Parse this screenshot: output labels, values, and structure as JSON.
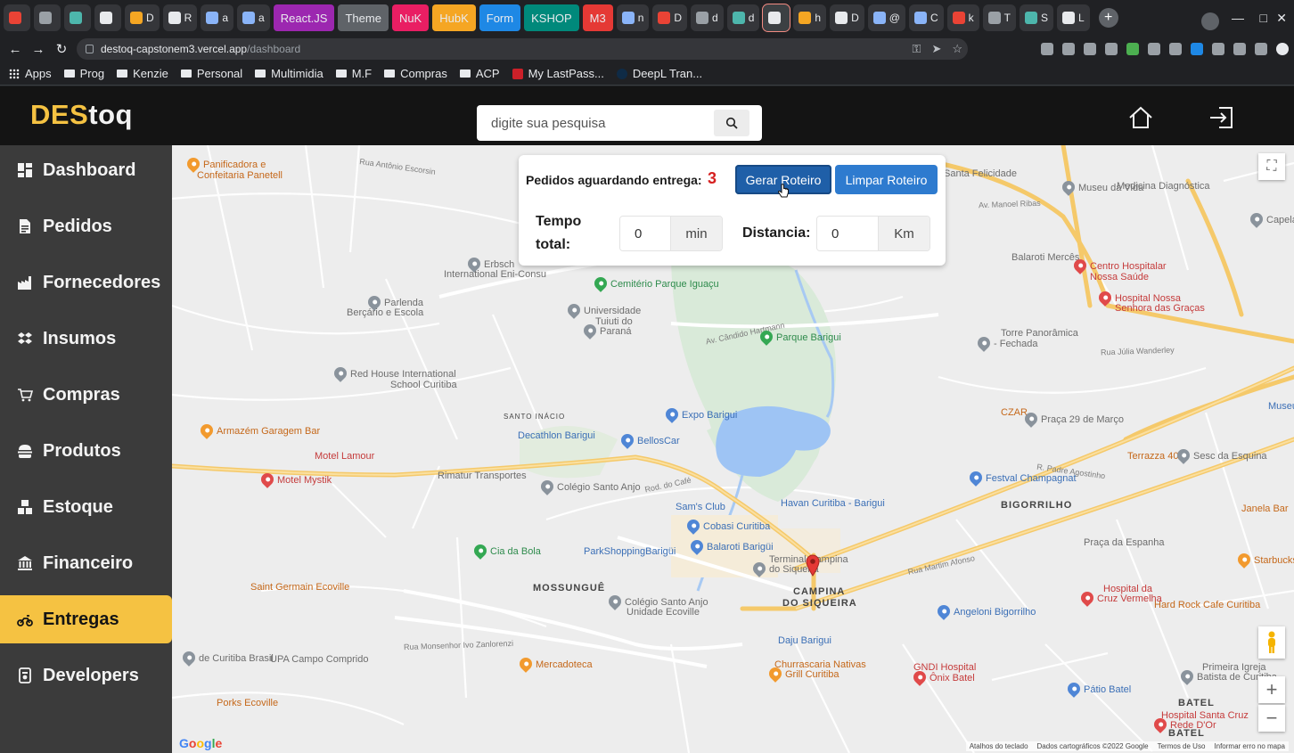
{
  "browser": {
    "tabs": [
      {
        "label": ""
      },
      {
        "label": ""
      },
      {
        "label": ""
      },
      {
        "label": ""
      },
      {
        "label": "D"
      },
      {
        "label": "R"
      },
      {
        "label": "a"
      },
      {
        "label": "a"
      },
      {
        "label": "React.JS",
        "color": "#9c27b0"
      },
      {
        "label": "Theme",
        "color": "#5f6368"
      },
      {
        "label": "NuK",
        "color": "#e91e63"
      },
      {
        "label": "HubK",
        "color": "#f5a623"
      },
      {
        "label": "Form",
        "color": "#1e88e5"
      },
      {
        "label": "KSHOP",
        "color": "#00897b"
      },
      {
        "label": "M3",
        "color": "#e53935"
      },
      {
        "label": "n"
      },
      {
        "label": "D"
      },
      {
        "label": "d"
      },
      {
        "label": "d"
      },
      {
        "label": ""
      },
      {
        "label": "h"
      },
      {
        "label": "D"
      },
      {
        "label": "@"
      },
      {
        "label": "C"
      },
      {
        "label": "k"
      },
      {
        "label": "T"
      },
      {
        "label": "S"
      },
      {
        "label": "L"
      }
    ],
    "url_host": "destoq-capstonem3.vercel.app",
    "url_path": "/dashboard",
    "bookmarks": [
      {
        "label": "Apps",
        "icon": "apps-grid-icon"
      },
      {
        "label": "Prog",
        "icon": "folder-icon"
      },
      {
        "label": "Kenzie",
        "icon": "folder-icon"
      },
      {
        "label": "Personal",
        "icon": "folder-icon"
      },
      {
        "label": "Multimidia",
        "icon": "folder-icon"
      },
      {
        "label": "M.F",
        "icon": "folder-icon"
      },
      {
        "label": "Compras",
        "icon": "folder-icon"
      },
      {
        "label": "ACP",
        "icon": "folder-icon"
      },
      {
        "label": "My LastPass...",
        "icon": "lastpass-icon"
      },
      {
        "label": "DeepL Tran...",
        "icon": "deepl-icon"
      }
    ]
  },
  "header": {
    "logo_part1": "DES",
    "logo_part2": "toq",
    "search_placeholder": "digite sua pesquisa"
  },
  "sidebar": {
    "items": [
      {
        "label": "Dashboard",
        "icon": "dashboard-icon",
        "active": false
      },
      {
        "label": "Pedidos",
        "icon": "file-invoice-icon",
        "active": false
      },
      {
        "label": "Fornecedores",
        "icon": "industry-icon",
        "active": false
      },
      {
        "label": "Insumos",
        "icon": "dropbox-icon",
        "active": false
      },
      {
        "label": "Compras",
        "icon": "cart-icon",
        "active": false
      },
      {
        "label": "Produtos",
        "icon": "burger-icon",
        "active": false
      },
      {
        "label": "Estoque",
        "icon": "boxes-icon",
        "active": false
      },
      {
        "label": "Financeiro",
        "icon": "bank-icon",
        "active": false
      },
      {
        "label": "Entregas",
        "icon": "motorcycle-icon",
        "active": true
      },
      {
        "label": "Developers",
        "icon": "developers-icon",
        "active": false
      }
    ]
  },
  "route": {
    "pending_label": "Pedidos aguardando entrega:",
    "pending_count": "3",
    "generate_button": "Gerar Roteiro",
    "clear_button": "Limpar Roteiro",
    "time_label_line1": "Tempo",
    "time_label_line2": "total:",
    "time_value": "0",
    "time_unit": "min",
    "distance_label": "Distancia:",
    "distance_value": "0",
    "distance_unit": "Km"
  },
  "map": {
    "districts": [
      "SANTO INÁCIO",
      "MOSSUNGUÊ",
      "CAMPINA",
      "DO SIQUEIRA",
      "BIGORRILHO",
      "BATEL",
      "BATEL"
    ],
    "places": [
      {
        "text": "Panificadora e",
        "kind": "orange"
      },
      {
        "text": "Confeitaria Panetell",
        "kind": "orange"
      },
      {
        "text": "Rua Antônio Escorsin",
        "kind": "street"
      },
      {
        "text": "Santa Felicidade",
        "kind": "grey"
      },
      {
        "text": "Museu da Vida",
        "kind": "grey"
      },
      {
        "text": "Medicina Diagnóstica",
        "kind": "grey"
      },
      {
        "text": "Capela V",
        "kind": "grey"
      },
      {
        "text": "Av. Manoel Ribas",
        "kind": "street"
      },
      {
        "text": "Erbsch",
        "kind": "grey"
      },
      {
        "text": "International Eni-Consu",
        "kind": "grey"
      },
      {
        "text": "Cemitério Parque Iguaçu",
        "kind": "green"
      },
      {
        "text": "Balaroti Mercês",
        "kind": "grey"
      },
      {
        "text": "Centro Hospitalar",
        "kind": "red"
      },
      {
        "text": "Nossa Saúde",
        "kind": "red"
      },
      {
        "text": "Hospital Nossa",
        "kind": "red"
      },
      {
        "text": "Senhora das Graças",
        "kind": "red"
      },
      {
        "text": "Parlenda",
        "kind": "grey"
      },
      {
        "text": "Berçário e Escola",
        "kind": "grey"
      },
      {
        "text": "Universidade",
        "kind": "grey"
      },
      {
        "text": "Tuiuti do",
        "kind": "grey"
      },
      {
        "text": "Paraná",
        "kind": "grey"
      },
      {
        "text": "Av. Cândido Hartmann",
        "kind": "street"
      },
      {
        "text": "Parque Barigui",
        "kind": "green"
      },
      {
        "text": "Torre Panorâmica",
        "kind": "grey"
      },
      {
        "text": "- Fechada",
        "kind": "grey"
      },
      {
        "text": "Rua Júlia Wanderley",
        "kind": "street"
      },
      {
        "text": "Red House International",
        "kind": "grey"
      },
      {
        "text": "School Curitiba",
        "kind": "grey"
      },
      {
        "text": "Expo Barigui",
        "kind": "blue"
      },
      {
        "text": "CZAR",
        "kind": "orange"
      },
      {
        "text": "Praça 29 de Março",
        "kind": "grey"
      },
      {
        "text": "Museu",
        "kind": "blue"
      },
      {
        "text": "Armazém Garagem Bar",
        "kind": "orange"
      },
      {
        "text": "Decathlon Barigui",
        "kind": "blue"
      },
      {
        "text": "BellosCar",
        "kind": "blue"
      },
      {
        "text": "Terrazza 40",
        "kind": "orange"
      },
      {
        "text": "Sesc da Esquina",
        "kind": "grey"
      },
      {
        "text": "Motel Lamour",
        "kind": "red"
      },
      {
        "text": "Motel Mystik",
        "kind": "red"
      },
      {
        "text": "Rimatur Transportes",
        "kind": "grey"
      },
      {
        "text": "Colégio Santo Anjo",
        "kind": "grey"
      },
      {
        "text": "Havan Curitiba - Barigui",
        "kind": "blue"
      },
      {
        "text": "Festval Champagnat",
        "kind": "blue"
      },
      {
        "text": "Sam's Club",
        "kind": "blue"
      },
      {
        "text": "Cobasi Curitiba",
        "kind": "blue"
      },
      {
        "text": "Janela Bar",
        "kind": "orange"
      },
      {
        "text": "Cia da Bola",
        "kind": "green"
      },
      {
        "text": "ParkShoppingBarigüi",
        "kind": "blue"
      },
      {
        "text": "Balaroti Barigüi",
        "kind": "blue"
      },
      {
        "text": "Terminal Campina",
        "kind": "grey"
      },
      {
        "text": "do Siqueira",
        "kind": "grey"
      },
      {
        "text": "Praça da Espanha",
        "kind": "grey"
      },
      {
        "text": "Starbucks",
        "kind": "orange"
      },
      {
        "text": "Saint Germain Ecoville",
        "kind": "orange"
      },
      {
        "text": "Rua Martim Afonso",
        "kind": "street"
      },
      {
        "text": "Hospital da",
        "kind": "red"
      },
      {
        "text": "Cruz Vermelha",
        "kind": "red"
      },
      {
        "text": "Hard Rock Cafe Curitiba",
        "kind": "orange"
      },
      {
        "text": "Colégio Santo Anjo",
        "kind": "grey"
      },
      {
        "text": "Unidade Ecoville",
        "kind": "grey"
      },
      {
        "text": "Angeloni Bigorrilho",
        "kind": "blue"
      },
      {
        "text": "Daju Barigui",
        "kind": "blue"
      },
      {
        "text": "de Curitiba Brasil",
        "kind": "grey"
      },
      {
        "text": "UPA Campo Comprido",
        "kind": "grey"
      },
      {
        "text": "Mercadoteca",
        "kind": "orange"
      },
      {
        "text": "Churrascaria Nativas",
        "kind": "orange"
      },
      {
        "text": "Grill Curitiba",
        "kind": "orange"
      },
      {
        "text": "GNDI Hospital",
        "kind": "red"
      },
      {
        "text": "Ônix Batel",
        "kind": "red"
      },
      {
        "text": "Primeira Igreja",
        "kind": "grey"
      },
      {
        "text": "Batista de Curitiba",
        "kind": "grey"
      },
      {
        "text": "Porks Ecoville",
        "kind": "orange"
      },
      {
        "text": "Pátio Batel",
        "kind": "blue"
      },
      {
        "text": "Hospital Santa Cruz",
        "kind": "red"
      },
      {
        "text": "Rede D'Or",
        "kind": "red"
      },
      {
        "text": "Rod. do Café",
        "kind": "street"
      },
      {
        "text": "Rua Monsenhor Ivo Zanlorenzi",
        "kind": "street"
      },
      {
        "text": "R. Padre Agostinho",
        "kind": "street"
      }
    ],
    "footer": [
      "Atalhos do teclado",
      "Dados cartográficos ©2022 Google",
      "Termos de Uso",
      "Informar erro no mapa"
    ],
    "google_logo": "Google"
  }
}
